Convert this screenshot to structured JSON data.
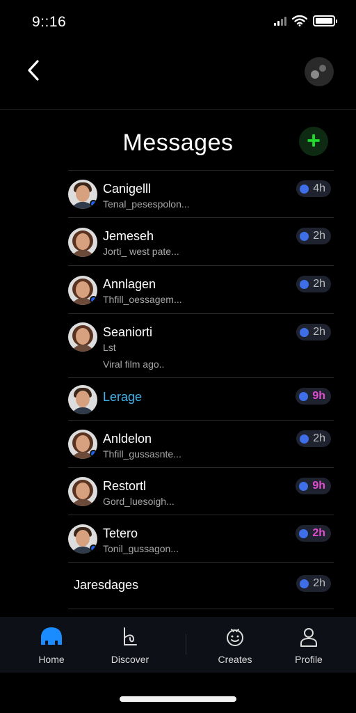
{
  "status_bar": {
    "time": "9::16"
  },
  "nav": {
    "back_icon": "chevron-left-icon",
    "menu_icon": "dots-icon"
  },
  "header": {
    "title": "Messages",
    "add_icon": "plus-icon",
    "accent": "#1fdc2c"
  },
  "messages": [
    {
      "name": "Canigelll",
      "snippet": "Tenal_pesespolon...",
      "time": "4h",
      "gender": "m",
      "online": true
    },
    {
      "name": "Jemeseh",
      "snippet": "Jorti_ west pate...",
      "time": "2h",
      "gender": "f",
      "online": false
    },
    {
      "name": "Annlagen",
      "snippet": "Thfill_oessagem...",
      "time": "2h",
      "gender": "f",
      "online": true
    },
    {
      "name": "Seaniorti",
      "snippet": "Lst",
      "snippet2": "Viral film ago..",
      "time": "2h",
      "gender": "f",
      "online": false
    },
    {
      "name": "Lerage",
      "snippet": "",
      "time": "9h",
      "gender": "m",
      "online": false,
      "highlight": true,
      "pink": true
    },
    {
      "name": "Anldelon",
      "snippet": "Thfill_gussasnte...",
      "time": "2h",
      "gender": "f",
      "online": true
    },
    {
      "name": "Restortl",
      "snippet": "Gord_luesoigh...",
      "time": "9h",
      "gender": "f",
      "online": false,
      "pink": true
    },
    {
      "name": "Tetero",
      "snippet": "Tonil_gussagon...",
      "time": "2h",
      "gender": "m",
      "online": true,
      "pink": true
    },
    {
      "name": "Jaresdages",
      "snippet": "",
      "time": "2h",
      "noavatar": true
    }
  ],
  "tabbar": {
    "tabs": [
      {
        "label": "Home",
        "icon": "home-icon"
      },
      {
        "label": "Discover",
        "icon": "discover-icon"
      },
      {
        "label": "Creates",
        "icon": "creates-icon"
      },
      {
        "label": "Profile",
        "icon": "profile-icon"
      }
    ]
  }
}
